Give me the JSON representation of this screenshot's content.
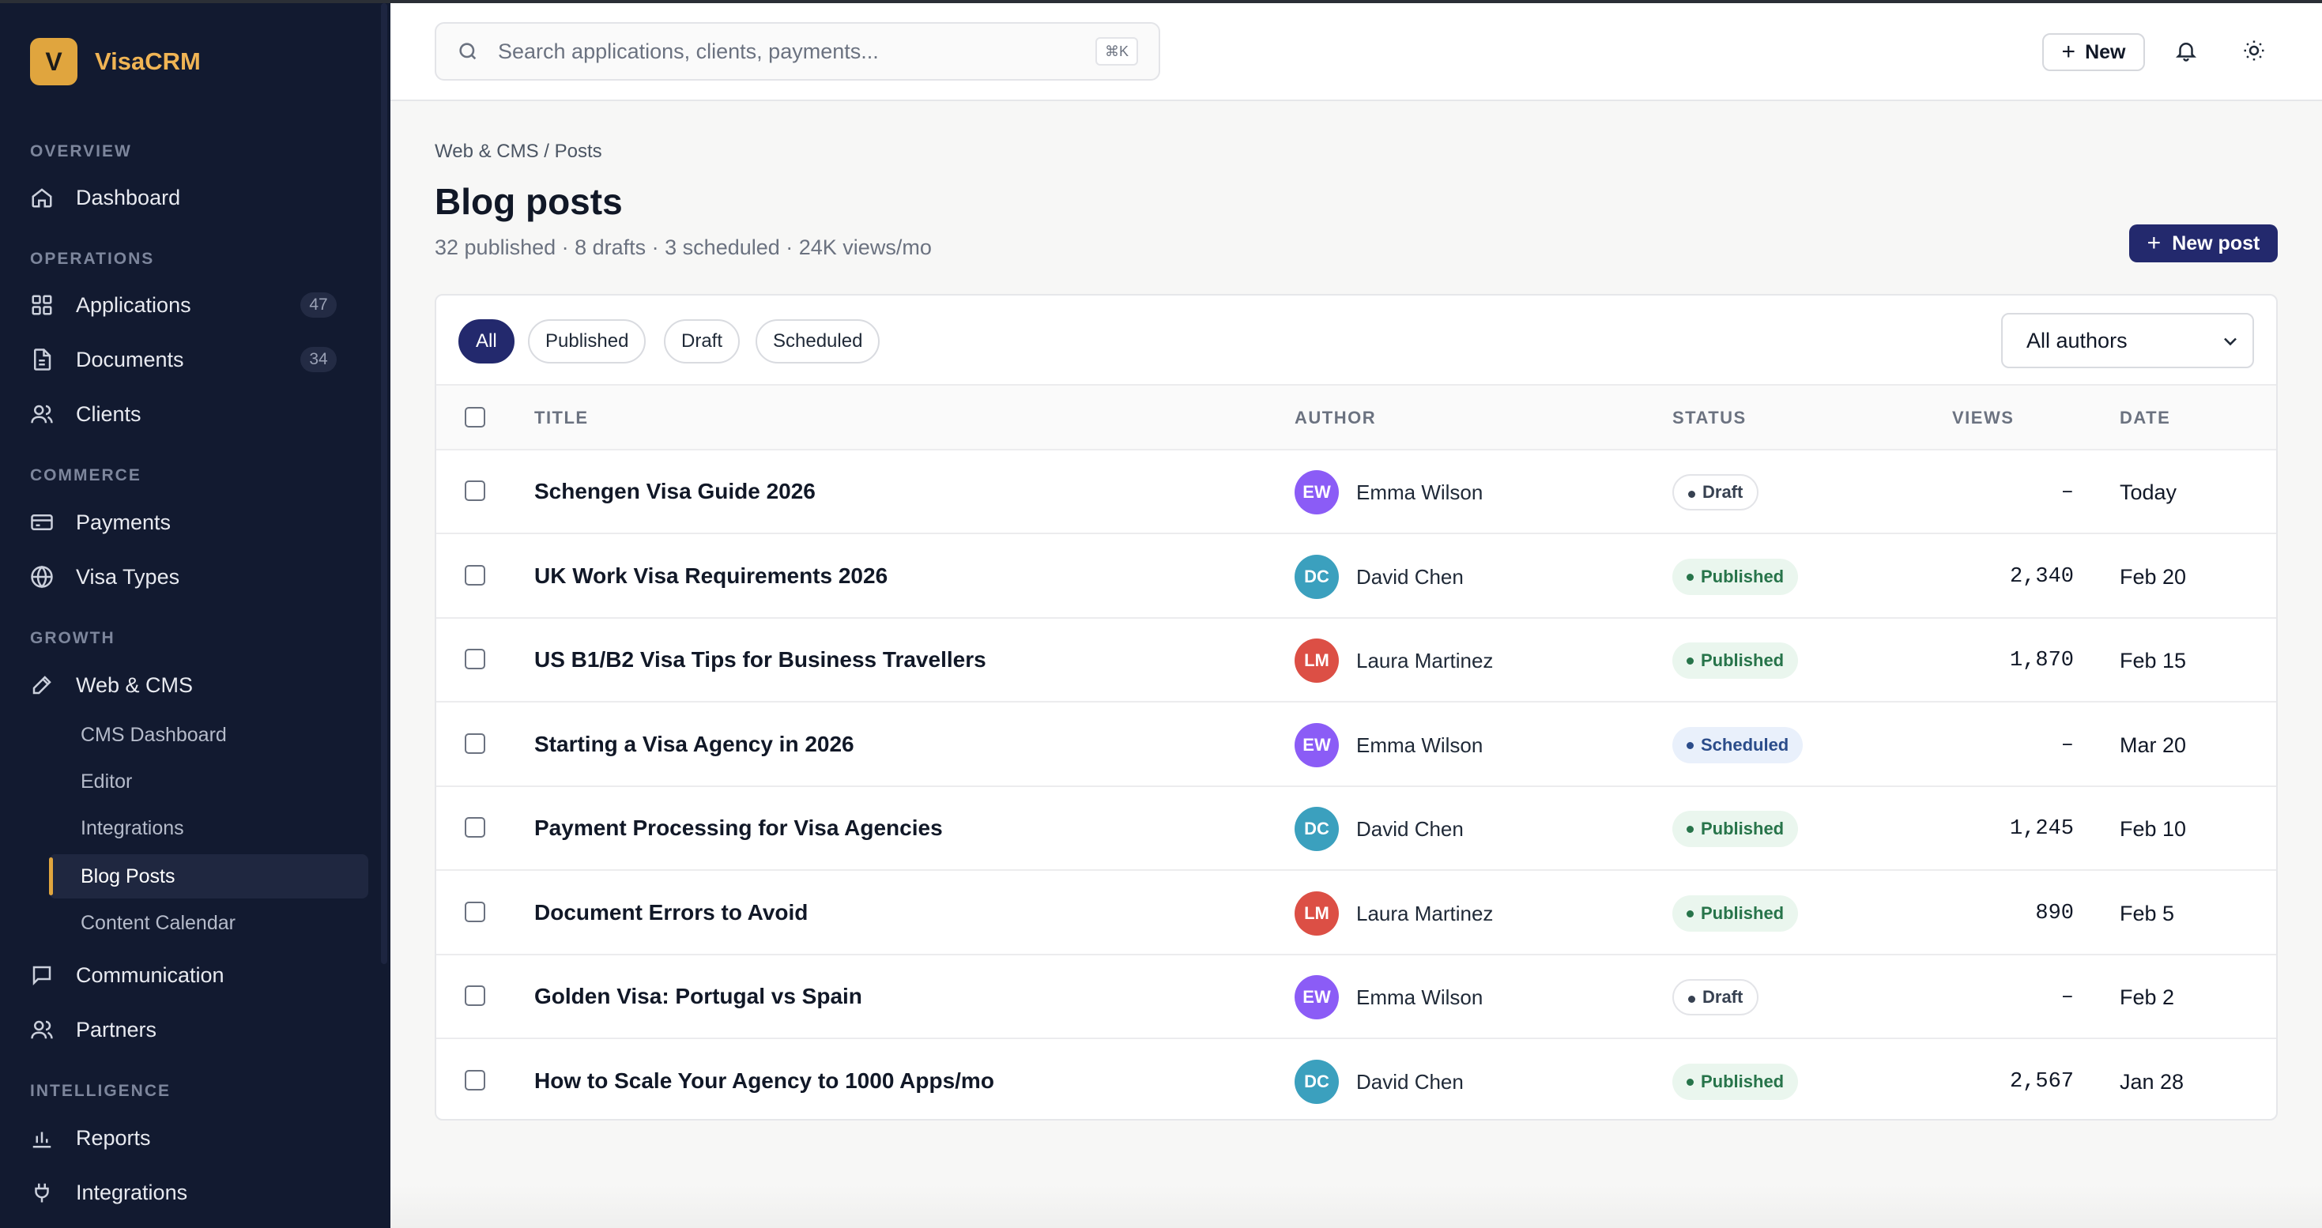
{
  "brand": {
    "logo_letter": "V",
    "name": "VisaCRM"
  },
  "sidebar": {
    "sections": {
      "overview": "OVERVIEW",
      "operations": "OPERATIONS",
      "commerce": "COMMERCE",
      "growth": "GROWTH",
      "intelligence": "INTELLIGENCE"
    },
    "items": {
      "dashboard": {
        "label": "Dashboard",
        "icon": "home-icon"
      },
      "applications": {
        "label": "Applications",
        "icon": "grid-icon",
        "count": "47"
      },
      "documents": {
        "label": "Documents",
        "icon": "document-icon",
        "count": "34"
      },
      "clients": {
        "label": "Clients",
        "icon": "users-icon"
      },
      "payments": {
        "label": "Payments",
        "icon": "credit-card-icon"
      },
      "visa_types": {
        "label": "Visa Types",
        "icon": "globe-icon"
      },
      "web_cms": {
        "label": "Web & CMS",
        "icon": "pencil-icon"
      },
      "communication": {
        "label": "Communication",
        "icon": "chat-icon"
      },
      "partners": {
        "label": "Partners",
        "icon": "users-icon"
      },
      "reports": {
        "label": "Reports",
        "icon": "bar-chart-icon"
      },
      "integrations": {
        "label": "Integrations",
        "icon": "plug-icon"
      }
    },
    "web_cms_children": [
      "CMS Dashboard",
      "Editor",
      "Integrations",
      "Blog Posts",
      "Content Calendar"
    ],
    "active_child": "Blog Posts"
  },
  "topbar": {
    "search_placeholder": "Search applications, clients, payments...",
    "search_shortcut": "⌘K",
    "new_label": "New"
  },
  "page": {
    "breadcrumb": "Web & CMS / Posts",
    "title": "Blog posts",
    "subtitle": "32 published · 8 drafts · 3 scheduled · 24K views/mo",
    "new_post_label": "New post"
  },
  "filters": {
    "chips": [
      "All",
      "Published",
      "Draft",
      "Scheduled"
    ],
    "active": "All",
    "author_select": "All authors"
  },
  "table": {
    "columns": {
      "title": "TITLE",
      "author": "AUTHOR",
      "status": "STATUS",
      "views": "VIEWS",
      "date": "DATE"
    },
    "rows": [
      {
        "title": "Schengen Visa Guide 2026",
        "author_initials": "EW",
        "author": "Emma Wilson",
        "avatar_color": "#8b5cf6",
        "status": "Draft",
        "status_kind": "draft",
        "views": "–",
        "date": "Today"
      },
      {
        "title": "UK Work Visa Requirements 2026",
        "author_initials": "DC",
        "author": "David Chen",
        "avatar_color": "#3ba0be",
        "status": "Published",
        "status_kind": "published",
        "views": "2,340",
        "date": "Feb 20"
      },
      {
        "title": "US B1/B2 Visa Tips for Business Travellers",
        "author_initials": "LM",
        "author": "Laura Martinez",
        "avatar_color": "#dc4f45",
        "status": "Published",
        "status_kind": "published",
        "views": "1,870",
        "date": "Feb 15"
      },
      {
        "title": "Starting a Visa Agency in 2026",
        "author_initials": "EW",
        "author": "Emma Wilson",
        "avatar_color": "#8b5cf6",
        "status": "Scheduled",
        "status_kind": "scheduled",
        "views": "–",
        "date": "Mar 20"
      },
      {
        "title": "Payment Processing for Visa Agencies",
        "author_initials": "DC",
        "author": "David Chen",
        "avatar_color": "#3ba0be",
        "status": "Published",
        "status_kind": "published",
        "views": "1,245",
        "date": "Feb 10"
      },
      {
        "title": "Document Errors to Avoid",
        "author_initials": "LM",
        "author": "Laura Martinez",
        "avatar_color": "#dc4f45",
        "status": "Published",
        "status_kind": "published",
        "views": "890",
        "date": "Feb 5"
      },
      {
        "title": "Golden Visa: Portugal vs Spain",
        "author_initials": "EW",
        "author": "Emma Wilson",
        "avatar_color": "#8b5cf6",
        "status": "Draft",
        "status_kind": "draft",
        "views": "–",
        "date": "Feb 2"
      },
      {
        "title": "How to Scale Your Agency to 1000 Apps/mo",
        "author_initials": "DC",
        "author": "David Chen",
        "avatar_color": "#3ba0be",
        "status": "Published",
        "status_kind": "published",
        "views": "2,567",
        "date": "Jan 28"
      }
    ]
  },
  "colors": {
    "sidebar_bg": "#121a30",
    "brand_accent": "#e0a53e",
    "primary": "#23296d"
  }
}
